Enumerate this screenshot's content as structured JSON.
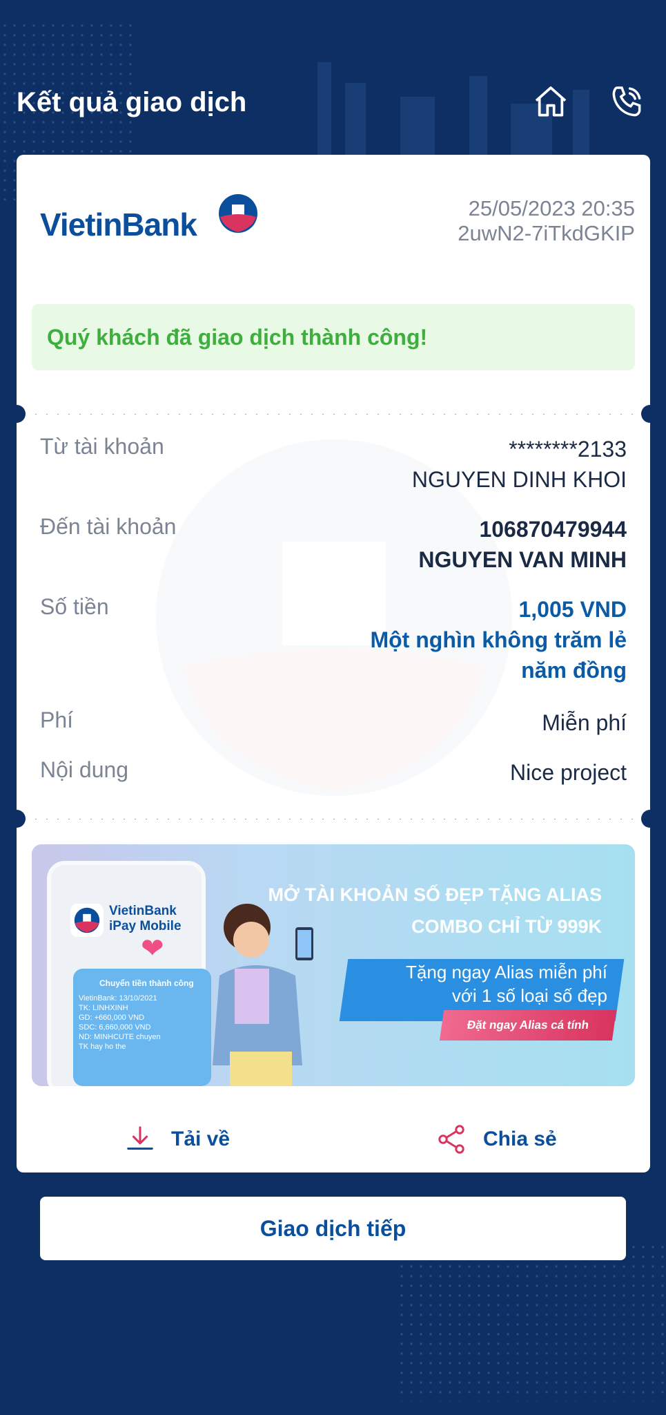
{
  "header": {
    "title": "Kết quả giao dịch",
    "home_icon": "home-icon",
    "call_icon": "phone-call-icon"
  },
  "receipt": {
    "brand": "VietinBank",
    "datetime": "25/05/2023 20:35",
    "transaction_code": "2uwN2-7iTkdGKIP",
    "success_message": "Quý khách đã giao dịch thành công!",
    "from": {
      "label": "Từ tài khoản",
      "account": "********2133",
      "name": "NGUYEN DINH KHOI"
    },
    "to": {
      "label": "Đến tài khoản",
      "account": "106870479944",
      "name": "NGUYEN VAN MINH"
    },
    "amount": {
      "label": "Số tiền",
      "value": "1,005 VND",
      "words_line1": "Một nghìn không trăm lẻ",
      "words_line2": "năm đồng"
    },
    "fee": {
      "label": "Phí",
      "value": "Miễn phí"
    },
    "content": {
      "label": "Nội dung",
      "value": "Nice project"
    }
  },
  "promo": {
    "phone_brand_line1": "VietinBank",
    "phone_brand_line2": "iPay Mobile",
    "phone_msg_title": "Chuyển tiền thành công",
    "phone_msg_lines": [
      "VietinBank: 13/10/2021",
      "TK: LINHXINH",
      "GD: +660,000 VND",
      "SDC: 6,660,000 VND",
      "ND: MINHCUTE chuyen",
      "TK hay ho the"
    ],
    "headline_line1": "MỞ TÀI KHOẢN SỐ ĐẸP TẶNG ALIAS",
    "headline_line2": "COMBO CHỈ TỪ 999K",
    "offer_line1": "Tặng ngay Alias miễn phí",
    "offer_line2": "với 1 số loại số đẹp",
    "cta": "Đặt ngay Alias cá tính"
  },
  "actions": {
    "download_label": "Tải về",
    "share_label": "Chia sẻ"
  },
  "next_button_label": "Giao dịch tiếp",
  "colors": {
    "background": "#0e2f63",
    "brand_blue": "#0b4f9c",
    "success_green": "#3fae3e",
    "brand_red": "#d8345f"
  }
}
